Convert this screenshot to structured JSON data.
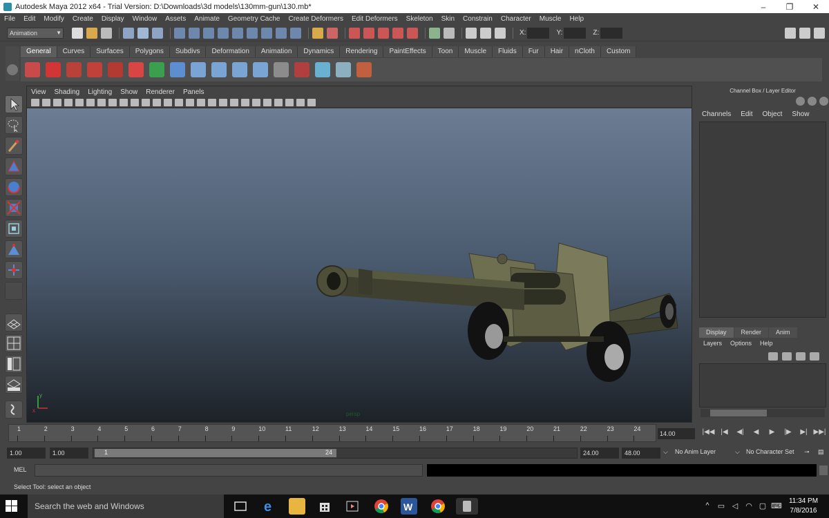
{
  "window": {
    "title": "Autodesk Maya 2012 x64 - Trial Version: D:\\Downloads\\3d models\\130mm-gun\\130.mb*",
    "minimize": "–",
    "maximize": "❐",
    "close": "✕"
  },
  "menu": [
    "File",
    "Edit",
    "Modify",
    "Create",
    "Display",
    "Window",
    "Assets",
    "Animate",
    "Geometry Cache",
    "Create Deformers",
    "Edit Deformers",
    "Skeleton",
    "Skin",
    "Constrain",
    "Character",
    "Muscle",
    "Help"
  ],
  "status_line": {
    "mode": "Animation",
    "x_label": "X:",
    "y_label": "Y:",
    "z_label": "Z:"
  },
  "shelf": {
    "tabs": [
      "General",
      "Curves",
      "Surfaces",
      "Polygons",
      "Subdivs",
      "Deformation",
      "Animation",
      "Dynamics",
      "Rendering",
      "PaintEffects",
      "Toon",
      "Muscle",
      "Fluids",
      "Fur",
      "Hair",
      "nCloth",
      "Custom"
    ],
    "active_tab": "General",
    "icon_colors": [
      "#c94a4a",
      "#d23535",
      "#b8423a",
      "#c0403a",
      "#b33a33",
      "#d84545",
      "#3aa050",
      "#5d8fd0",
      "#7aa4d4",
      "#7aa4d4",
      "#7aa4d4",
      "#7aa4d4",
      "#8c8c8c",
      "#b04040",
      "#6ab0d0",
      "#8cb0c0",
      "#c06040"
    ]
  },
  "viewport": {
    "menu": [
      "View",
      "Shading",
      "Lighting",
      "Show",
      "Renderer",
      "Panels"
    ],
    "camera_label": "persp"
  },
  "channel_box": {
    "header": "Channel Box / Layer Editor",
    "menu": [
      "Channels",
      "Edit",
      "Object",
      "Show"
    ]
  },
  "layer_editor": {
    "tabs": [
      "Display",
      "Render",
      "Anim"
    ],
    "active_tab": "Display",
    "menu": [
      "Layers",
      "Options",
      "Help"
    ]
  },
  "time_slider": {
    "ticks": [
      "1",
      "2",
      "3",
      "4",
      "5",
      "6",
      "7",
      "8",
      "9",
      "10",
      "11",
      "12",
      "13",
      "14",
      "15",
      "16",
      "17",
      "18",
      "19",
      "20",
      "21",
      "22",
      "23",
      "24"
    ],
    "current_frame": "14.00",
    "playback_buttons": [
      "|◀◀",
      "|◀",
      "◀|",
      "◀",
      "▶",
      "|▶",
      "▶|",
      "▶▶|"
    ]
  },
  "range_slider": {
    "start_time": "1.00",
    "playback_start": "1.00",
    "range_start_label": "1",
    "range_end_label": "24",
    "playback_end": "24.00",
    "end_time": "48.00",
    "anim_layer": "No Anim Layer",
    "character_set": "No Character Set"
  },
  "command_line": {
    "label": "MEL"
  },
  "help_line": "Select Tool: select an object",
  "taskbar": {
    "search_placeholder": "Search the web and Windows",
    "time": "11:34 PM",
    "date": "7/8/2016"
  }
}
